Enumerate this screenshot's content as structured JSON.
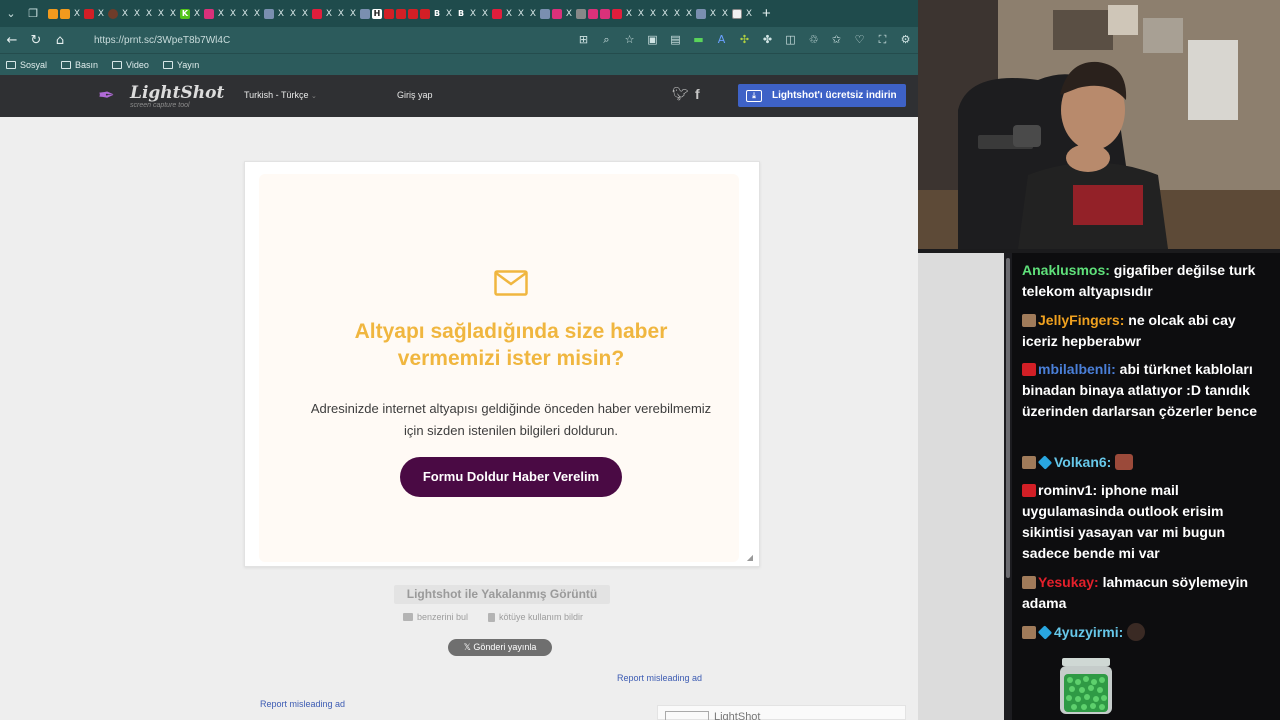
{
  "browser": {
    "tab_close_symbol": "X",
    "new_tab_symbol": "+",
    "url": "https://prnt.sc/3WpeT8b7Wl4C",
    "bookmarks": [
      "Sosyal",
      "Basın",
      "Video",
      "Yayın"
    ],
    "nav": {
      "back": "←",
      "reload": "↻",
      "home": "⌂"
    },
    "tab_letters": {
      "h": "H",
      "b1": "B",
      "b2": "B",
      "k": "K"
    }
  },
  "lightshot": {
    "logo_name": "LightShot",
    "logo_sub": "screen capture tool",
    "language": "Turkish - Türkçe",
    "login": "Giriş yap",
    "download_btn": "Lightshot'ı ücretsiz indirin",
    "ad": {
      "title": "Altyapı sağladığında size haber vermemizi ister misin?",
      "description": "Adresinizde internet altyapısı geldiğinde önceden haber verebilmemiz için sizden istenilen bilgileri doldurun.",
      "cta": "Formu Doldur Haber Verelim"
    },
    "capture_label": "Lightshot ile Yakalanmış Görüntü",
    "find_similar": "benzerini bul",
    "report_abuse": "kötüye kullanım bildir",
    "tweet": "Gönderi yayınla",
    "report_ad_1": "Report misleading ad",
    "report_ad_2": "Report misleading ad",
    "bottom_ad_text": "LightShot"
  },
  "chat": {
    "messages": [
      {
        "user": "Anaklusmos:",
        "text": " gigafiber değilse turk telekom altyapısıdır"
      },
      {
        "user": "JellyFingers:",
        "text": " ne olcak abi cay iceriz hepberabwr"
      },
      {
        "user": "mbilalbenli:",
        "text": " abi türknet kabloları binadan binaya atlatıyor :D tanıdık üzerinden darlarsan çözerler bence"
      },
      {
        "user": "Volkan6:",
        "text": " "
      },
      {
        "user": "rominv1:",
        "text": " iphone mail uygulamasinda outlook erisim sikintisi yasayan var mi bugun sadece bende mi var"
      },
      {
        "user": "Yesukay:",
        "text": " lahmacun söylemeyin adama"
      },
      {
        "user": "4yuzyirmi:",
        "text": " "
      }
    ]
  }
}
